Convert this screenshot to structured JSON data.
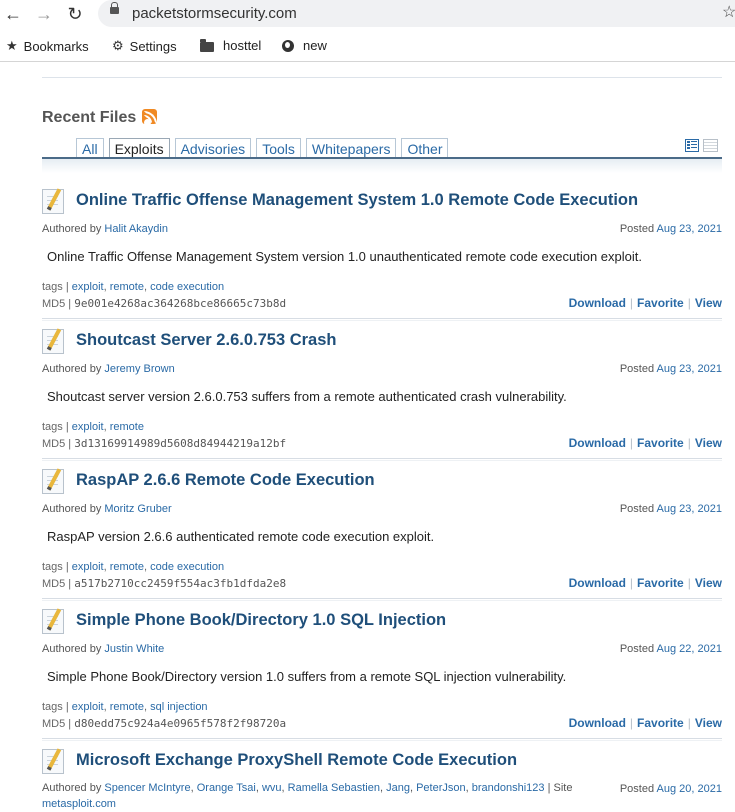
{
  "browser": {
    "url": "packetstormsecurity.com",
    "bookmarks": [
      {
        "label": "Bookmarks",
        "icon": "star-icon"
      },
      {
        "label": "Settings",
        "icon": "gear-icon"
      },
      {
        "label": "hosttel",
        "icon": "folder-icon"
      },
      {
        "label": "new",
        "icon": "globe-icon"
      }
    ]
  },
  "section": {
    "title": "Recent Files",
    "tabs": [
      "All",
      "Exploits",
      "Advisories",
      "Tools",
      "Whitepapers",
      "Other"
    ],
    "active_tab": "Exploits"
  },
  "labels": {
    "authored_by": "Authored by",
    "posted": "Posted",
    "tags": "tags |",
    "md5": "MD5 |",
    "download": "Download",
    "favorite": "Favorite",
    "view": "View",
    "sep": "|",
    "comma": ","
  },
  "files": [
    {
      "title": "Online Traffic Offense Management System 1.0 Remote Code Execution",
      "author": "Halit Akaydin",
      "date": "Aug 23, 2021",
      "description": "Online Traffic Offense Management System version 1.0 unauthenticated remote code execution exploit.",
      "tags": [
        "exploit",
        "remote",
        "code execution"
      ],
      "md5": "9e001e4268ac364268bce86665c73b8d"
    },
    {
      "title": "Shoutcast Server 2.6.0.753 Crash",
      "author": "Jeremy Brown",
      "date": "Aug 23, 2021",
      "description": "Shoutcast server version 2.6.0.753 suffers from a remote authenticated crash vulnerability.",
      "tags": [
        "exploit",
        "remote"
      ],
      "md5": "3d13169914989d5608d84944219a12bf"
    },
    {
      "title": "RaspAP 2.6.6 Remote Code Execution",
      "author": "Moritz Gruber",
      "date": "Aug 23, 2021",
      "description": "RaspAP version 2.6.6 authenticated remote code execution exploit.",
      "tags": [
        "exploit",
        "remote",
        "code execution"
      ],
      "md5": "a517b2710cc2459f554ac3fb1dfda2e8"
    },
    {
      "title": "Simple Phone Book/Directory 1.0 SQL Injection",
      "author": "Justin White",
      "date": "Aug 22, 2021",
      "description": "Simple Phone Book/Directory version 1.0 suffers from a remote SQL injection vulnerability.",
      "tags": [
        "exploit",
        "remote",
        "sql injection"
      ],
      "md5": "d80edd75c924a4e0965f578f2f98720a"
    },
    {
      "title": "Microsoft Exchange ProxyShell Remote Code Execution",
      "authors": [
        "Spencer McIntyre",
        "Orange Tsai",
        "wvu",
        "Ramella Sebastien",
        "Jang",
        "PeterJson",
        "brandonshi123"
      ],
      "site_label": "| Site",
      "site": "metasploit.com",
      "date": "Aug 20, 2021"
    }
  ]
}
